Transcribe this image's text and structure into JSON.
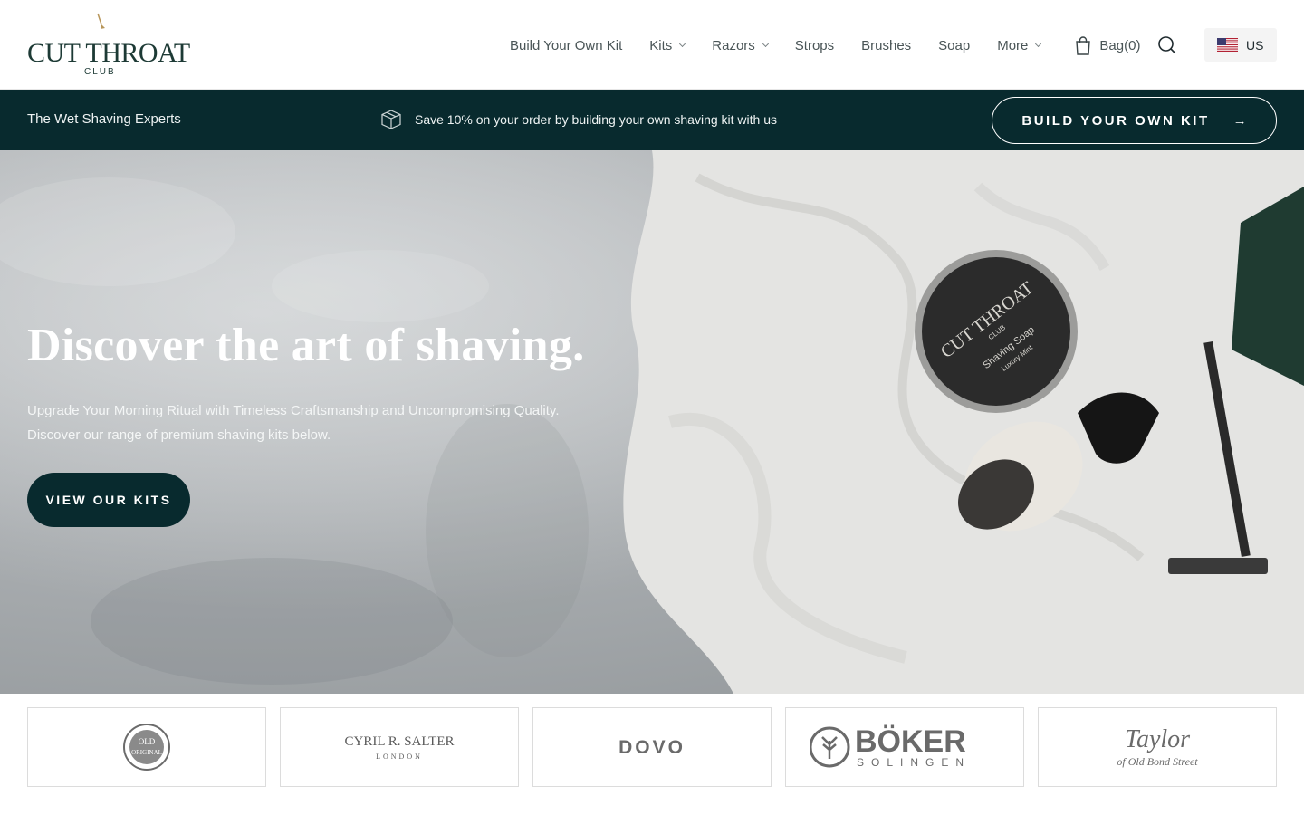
{
  "header": {
    "logo_title": "CUT THROAT",
    "logo_sub": "CLUB",
    "nav": [
      {
        "label": "Build Your Own Kit",
        "has_dropdown": false
      },
      {
        "label": "Kits",
        "has_dropdown": true
      },
      {
        "label": "Razors",
        "has_dropdown": true
      },
      {
        "label": "Strops",
        "has_dropdown": false
      },
      {
        "label": "Brushes",
        "has_dropdown": false
      },
      {
        "label": "Soap",
        "has_dropdown": false
      },
      {
        "label": "More",
        "has_dropdown": true
      }
    ],
    "bag_label": "Bag",
    "bag_count": "(0)",
    "region_label": "US",
    "icons": {
      "bag": "bag-icon",
      "search": "search-icon",
      "flag": "us-flag-icon"
    }
  },
  "promo": {
    "tagline": "The Wet Shaving Experts",
    "message": "Save 10% on your order by building your own shaving kit with us",
    "button_label": "BUILD YOUR OWN KIT",
    "button_arrow": "→",
    "icons": {
      "box": "box-icon",
      "arrow": "arrow-right-icon"
    }
  },
  "hero": {
    "title": "Discover the art of shaving.",
    "body_line1": "Upgrade Your Morning Ritual with Timeless Craftsmanship and Uncompromising Quality.",
    "body_line2": "Discover our range of premium shaving kits below.",
    "cta_label": "VIEW OUR KITS",
    "soap_tin_title": "CUT THROAT",
    "soap_tin_sub": "CLUB",
    "soap_tin_product": "Shaving Soap",
    "soap_tin_variant": "Luxury Mint"
  },
  "brands": [
    {
      "name": "old-original-logo",
      "line1": "OLD",
      "line2": "ORIGINAL"
    },
    {
      "name": "cyril-r-salter-logo",
      "line1": "CYRIL R. SALTER",
      "line2": "LONDON"
    },
    {
      "name": "dovo-logo",
      "line1": "DOVO",
      "line2": ""
    },
    {
      "name": "boker-logo",
      "line1": "BÖKER",
      "line2": "SOLINGEN"
    },
    {
      "name": "taylor-logo",
      "line1": "Taylor",
      "line2": "of Old Bond Street"
    }
  ],
  "colors": {
    "brand_dark": "#082a2e",
    "logo_green": "#1d3a35",
    "text_muted": "#4a5557",
    "accent_gold": "#b8965a"
  }
}
